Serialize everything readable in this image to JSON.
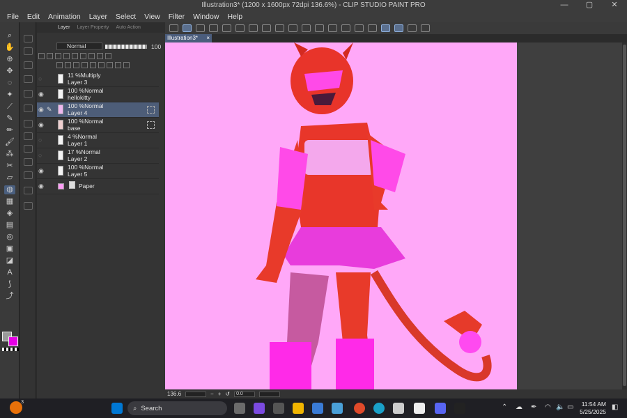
{
  "window": {
    "title": "Illustration3* (1200 x 1600px 72dpi 136.6%) - CLIP STUDIO PAINT PRO",
    "minimize": "—",
    "maximize": "▢",
    "close": "✕"
  },
  "menu": [
    "File",
    "Edit",
    "Animation",
    "Layer",
    "Select",
    "View",
    "Filter",
    "Window",
    "Help"
  ],
  "layer_panel": {
    "tabs": [
      "Layer",
      "Layer Property",
      "Auto Action"
    ],
    "blend_mode": "Normal",
    "opacity": "100",
    "layers": [
      {
        "opacity": "11 %",
        "mode": "Multiply",
        "name": "Layer 3",
        "visible": false,
        "selected": false
      },
      {
        "opacity": "100 %",
        "mode": "Normal",
        "name": "hellokitty",
        "visible": true,
        "selected": false
      },
      {
        "opacity": "100 %",
        "mode": "Normal",
        "name": "Layer 4",
        "visible": true,
        "selected": true
      },
      {
        "opacity": "100 %",
        "mode": "Normal",
        "name": "base",
        "visible": true,
        "selected": false
      },
      {
        "opacity": "4 %",
        "mode": "Normal",
        "name": "Layer 1",
        "visible": false,
        "selected": false
      },
      {
        "opacity": "17 %",
        "mode": "Normal",
        "name": "Layer 2",
        "visible": false,
        "selected": false
      },
      {
        "opacity": "100 %",
        "mode": "Normal",
        "name": "Layer 5",
        "visible": true,
        "selected": false
      }
    ],
    "paper": {
      "name": "Paper",
      "color": "#ff9ef5"
    }
  },
  "document": {
    "tab_label": "Illustration3*",
    "canvas_color": "#ffa8f8"
  },
  "status": {
    "zoom": "136.6",
    "angle": "0.0"
  },
  "colors": {
    "main": "#9a9a9a",
    "sub": "#e600e6"
  },
  "taskbar": {
    "search_placeholder": "Search",
    "time": "11:54 AM",
    "date": "5/25/2025",
    "notification_count": "3"
  }
}
